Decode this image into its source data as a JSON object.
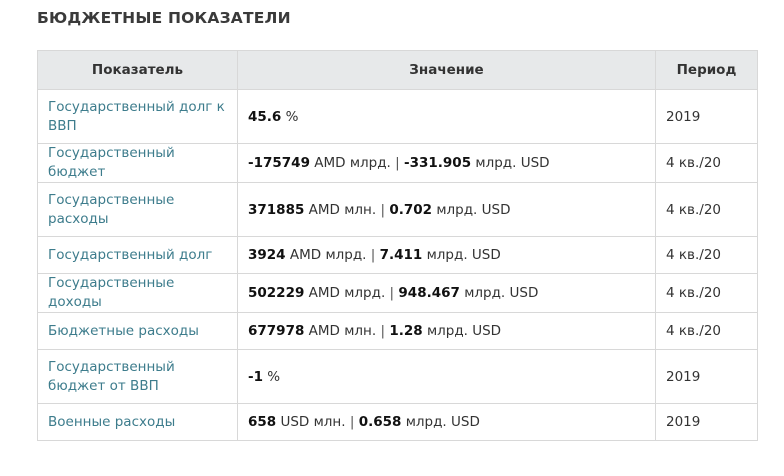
{
  "title": "БЮДЖЕТНЫЕ ПОКАЗАТЕЛИ",
  "columns": {
    "indicator": "Показатель",
    "value": "Значение",
    "period": "Период"
  },
  "rows": [
    {
      "name": "Государственный долг к ВВП",
      "v1": "45.6",
      "u1": "%",
      "v2": "",
      "u2": "",
      "period": "2019"
    },
    {
      "name": "Государственный бюджет",
      "v1": "-175749",
      "u1": "AMD млрд.",
      "v2": "-331.905",
      "u2": "млрд. USD",
      "period": "4 кв./20"
    },
    {
      "name": "Государственные расходы",
      "v1": "371885",
      "u1": "AMD млн.",
      "v2": "0.702",
      "u2": "млрд. USD",
      "period": "4 кв./20"
    },
    {
      "name": "Государственный долг",
      "v1": "3924",
      "u1": "AMD млрд.",
      "v2": "7.411",
      "u2": "млрд. USD",
      "period": "4 кв./20"
    },
    {
      "name": "Государственные доходы",
      "v1": "502229",
      "u1": "AMD млрд.",
      "v2": "948.467",
      "u2": "млрд. USD",
      "period": "4 кв./20"
    },
    {
      "name": "Бюджетные расходы",
      "v1": "677978",
      "u1": "AMD млн.",
      "v2": "1.28",
      "u2": "млрд. USD",
      "period": "4 кв./20"
    },
    {
      "name": "Государственный бюджет от ВВП",
      "v1": "-1",
      "u1": "%",
      "v2": "",
      "u2": "",
      "period": "2019"
    },
    {
      "name": "Военные расходы",
      "v1": "658",
      "u1": "USD млн.",
      "v2": "0.658",
      "u2": "млрд. USD",
      "period": "2019"
    }
  ]
}
